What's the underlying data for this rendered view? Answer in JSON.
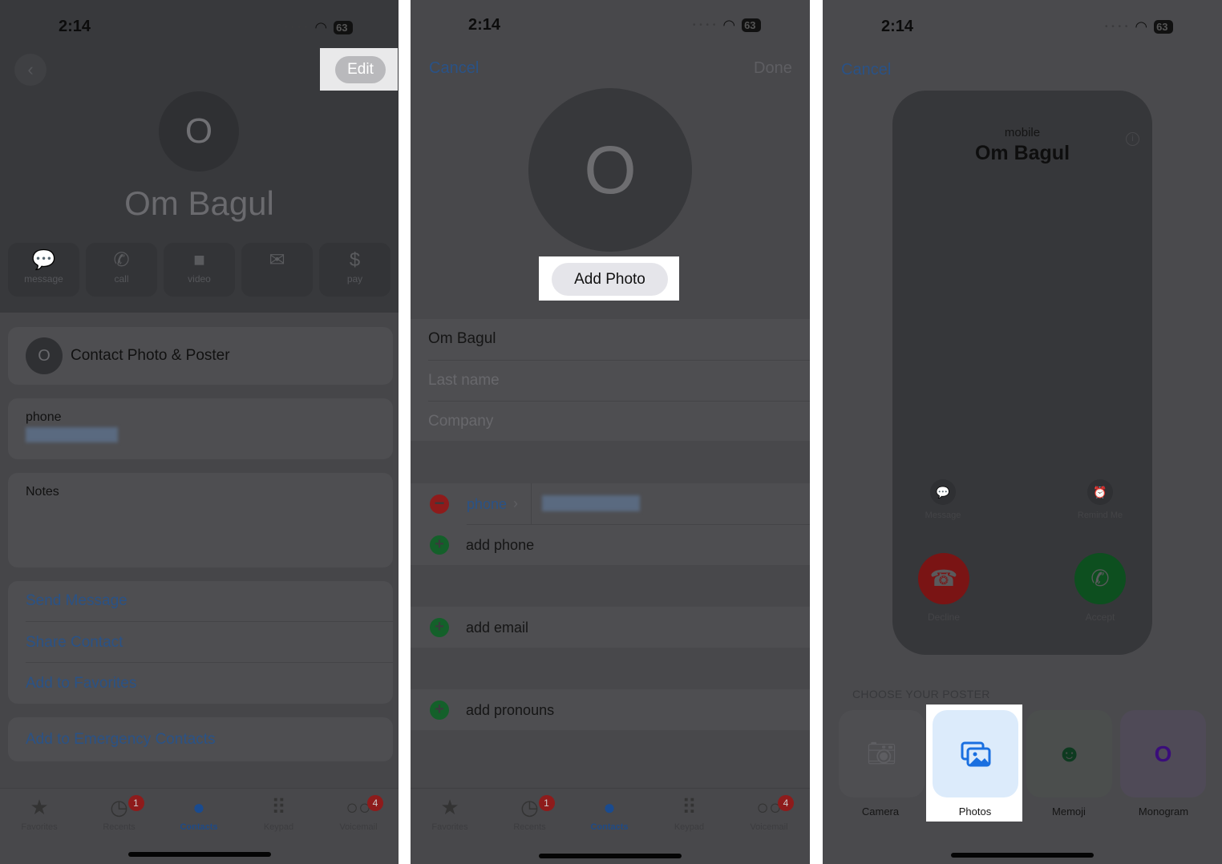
{
  "status": {
    "time": "2:14",
    "battery": "63"
  },
  "contact": {
    "initial": "O",
    "name": "Om Bagul"
  },
  "panel1": {
    "edit_label": "Edit",
    "actions": [
      {
        "icon": "message-icon",
        "glyph": "💬",
        "label": "message"
      },
      {
        "icon": "phone-icon",
        "glyph": "✆",
        "label": "call"
      },
      {
        "icon": "video-icon",
        "glyph": "■",
        "label": "video"
      },
      {
        "icon": "mail-icon",
        "glyph": "✉",
        "label": ""
      },
      {
        "icon": "dollar-icon",
        "glyph": "$",
        "label": "pay"
      }
    ],
    "photo_poster_label": "Contact Photo & Poster",
    "phone_label": "phone",
    "notes_label": "Notes",
    "links": [
      "Send Message",
      "Share Contact",
      "Add to Favorites"
    ],
    "emergency_label": "Add to Emergency Contacts"
  },
  "tabs": [
    {
      "label": "Favorites",
      "glyph": "★"
    },
    {
      "label": "Recents",
      "glyph": "◷",
      "badge": "1"
    },
    {
      "label": "Contacts",
      "glyph": "●"
    },
    {
      "label": "Keypad",
      "glyph": "⠿"
    },
    {
      "label": "Voicemail",
      "glyph": "○○",
      "badge": "4"
    }
  ],
  "panel2": {
    "cancel": "Cancel",
    "done": "Done",
    "add_photo": "Add Photo",
    "first_name": "Om Bagul",
    "last_name_placeholder": "Last name",
    "company_placeholder": "Company",
    "phone_label": "phone",
    "add_phone": "add phone",
    "add_email": "add email",
    "add_pronouns": "add pronouns"
  },
  "panel3": {
    "cancel": "Cancel",
    "label": "mobile",
    "name": "Om Bagul",
    "message": "Message",
    "remind": "Remind Me",
    "decline": "Decline",
    "accept": "Accept",
    "section": "CHOOSE YOUR POSTER",
    "options": [
      {
        "label": "Camera",
        "icon": "camera-icon"
      },
      {
        "label": "Photos",
        "icon": "photos-icon"
      },
      {
        "label": "Memoji",
        "icon": "memoji-icon"
      },
      {
        "label": "Monogram",
        "icon": "monogram-icon",
        "glyph": "O"
      }
    ]
  },
  "colors": {
    "accent": "#2a5286",
    "highlight": "#ffffff",
    "decline": "#7a1414",
    "accept": "#0d4f1f"
  }
}
